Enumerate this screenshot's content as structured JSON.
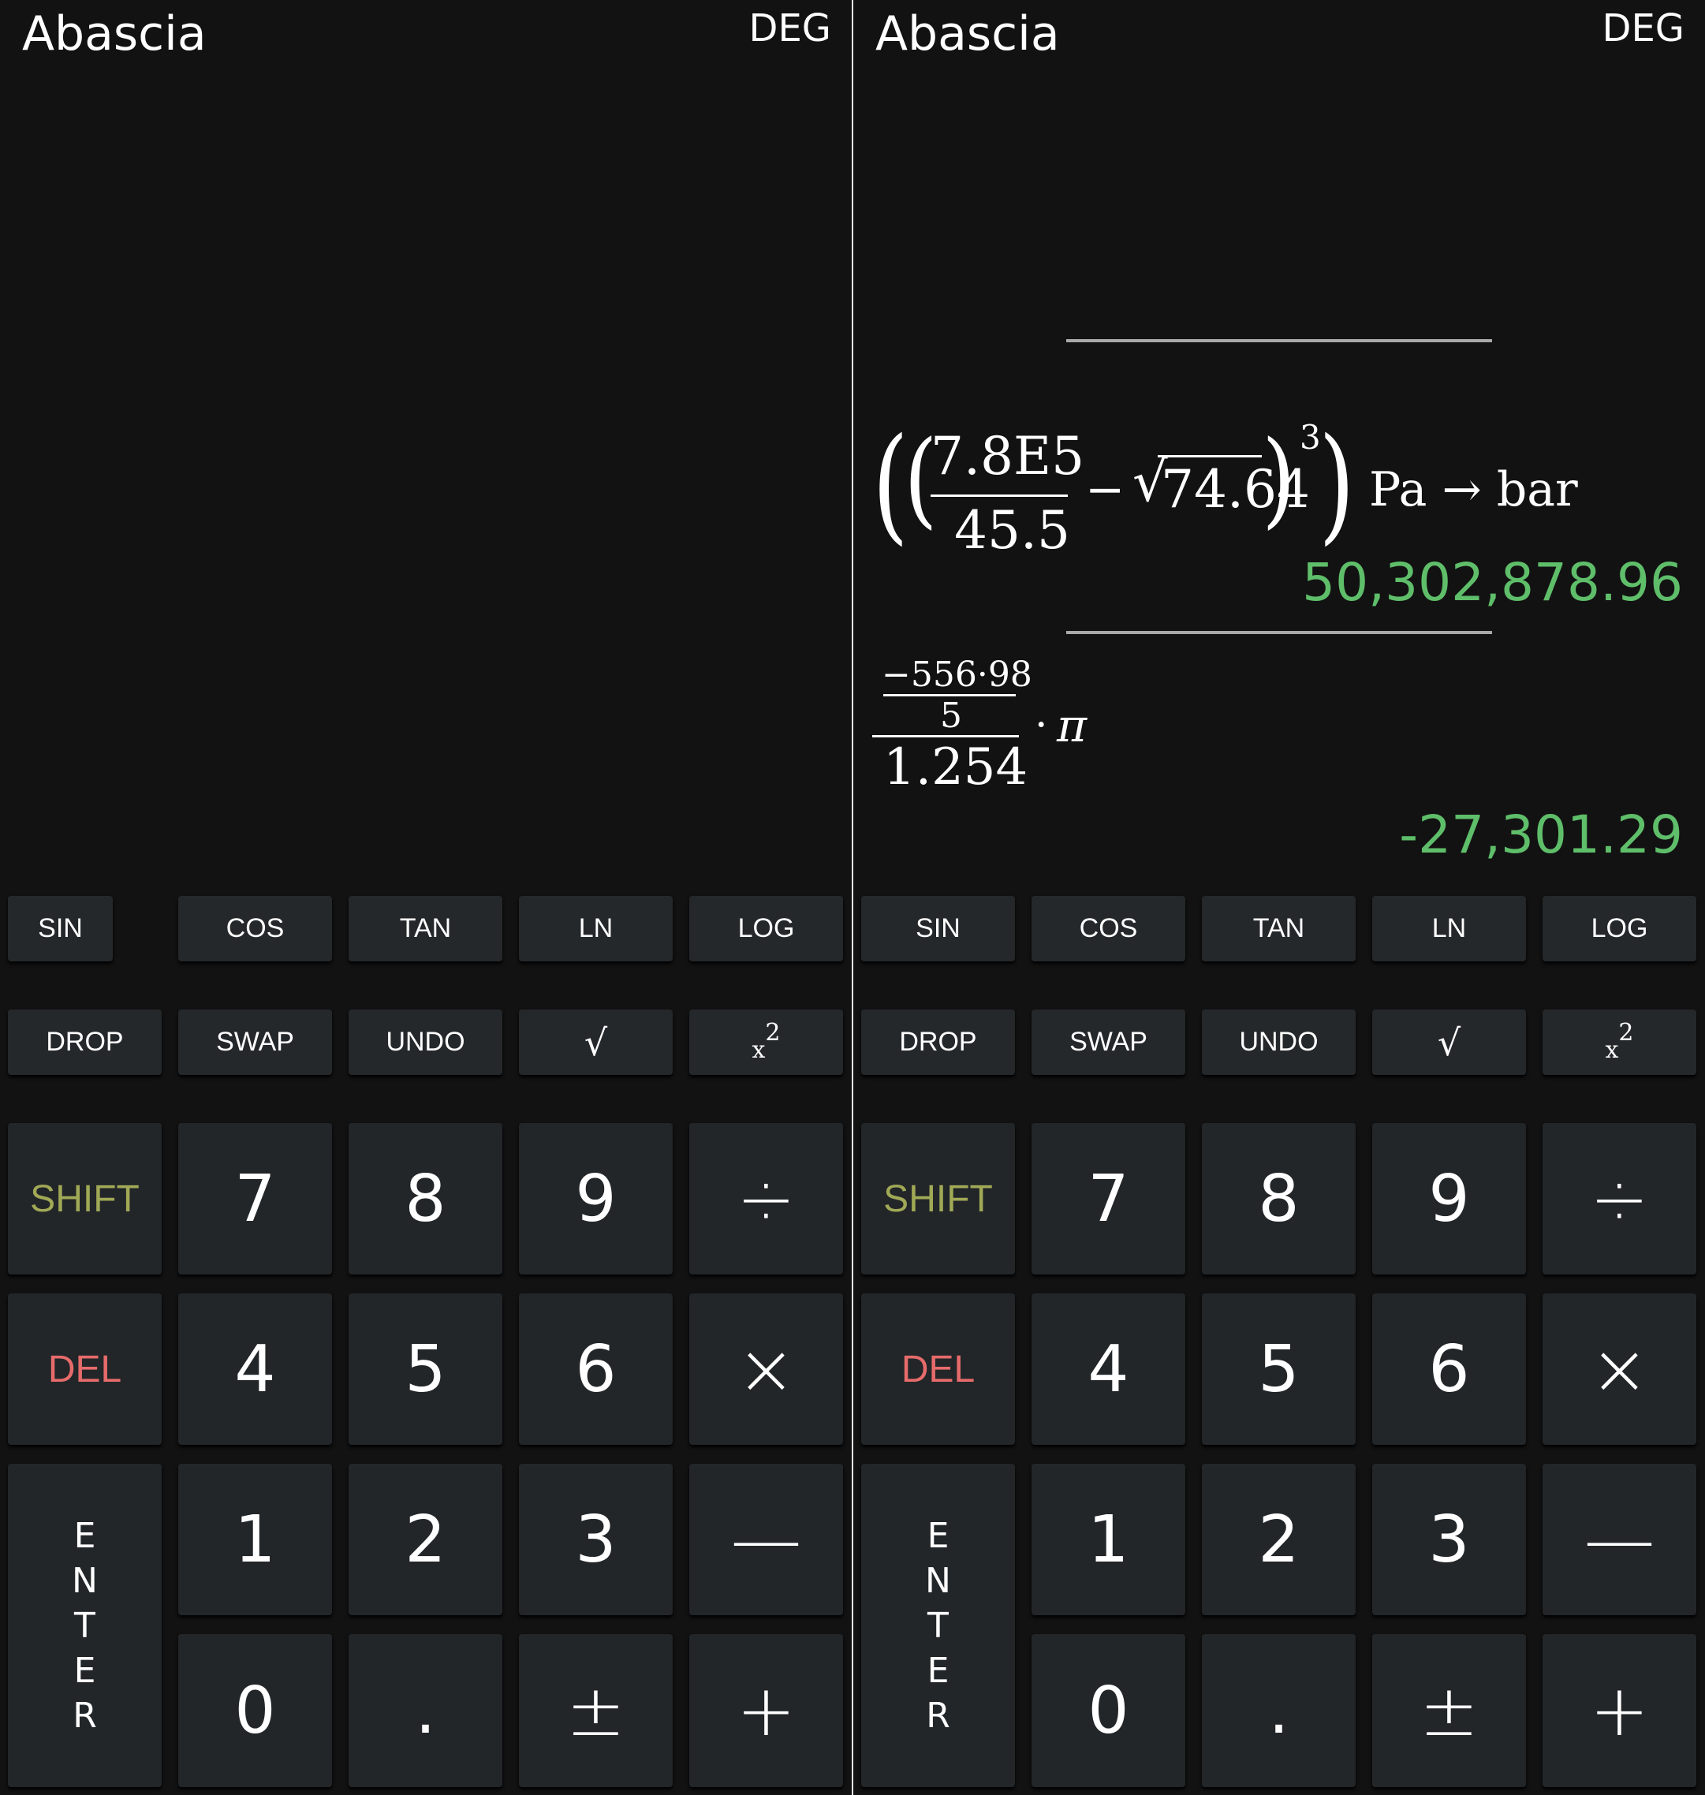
{
  "app": {
    "name": "Abascia",
    "angle_mode": "DEG"
  },
  "left": {
    "stack": []
  },
  "right": {
    "stack": [
      {
        "expression": {
          "open_outer": "(",
          "open_inner": "(",
          "numerator": "7.8E5",
          "denominator": "45.5",
          "minus": "−",
          "sqrt_symbol": "√",
          "radicand": "74.64",
          "close_inner": ")",
          "exponent": "3",
          "close_outer": ")",
          "conversion": "Pa → bar"
        },
        "result": "50,302,878.96"
      },
      {
        "expression": {
          "inner_numerator": "−556·98",
          "inner_denominator": "5",
          "denominator": "1.254",
          "times": "·",
          "factor": "π"
        },
        "result": "-27,301.29"
      }
    ]
  },
  "keypad": {
    "row1": [
      "SIN",
      "COS",
      "TAN",
      "LN",
      "LOG"
    ],
    "row2": [
      "DROP",
      "SWAP",
      "UNDO",
      "√",
      "x²"
    ],
    "shift": "SHIFT",
    "del": "DEL",
    "enter": [
      "E",
      "N",
      "T",
      "E",
      "R"
    ],
    "digits": [
      "7",
      "8",
      "9",
      "4",
      "5",
      "6",
      "1",
      "2",
      "3",
      "0"
    ],
    "dot": ".",
    "plusminus": "±",
    "divide": "÷",
    "multiply": "×",
    "subtract": "—",
    "add": "+",
    "square_base": "x",
    "square_exp": "2"
  },
  "colors": {
    "background": "#121212",
    "key": "#222629",
    "result": "#5fbe6a",
    "shift": "#a1a956",
    "del": "#e76b6b"
  }
}
